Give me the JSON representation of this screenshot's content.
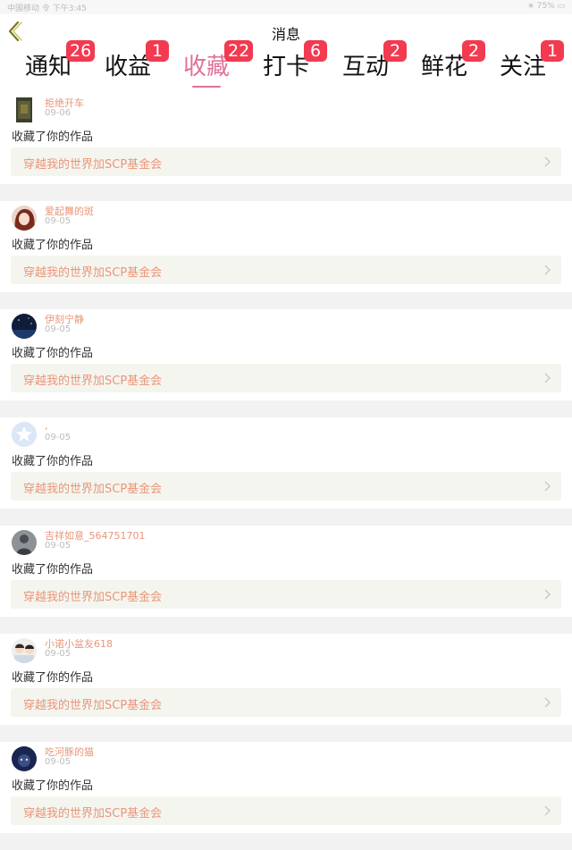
{
  "statusbar": {
    "left": "中国移动 令 下午3:45",
    "right": "∗ 75% ▭"
  },
  "header": {
    "title": "消息",
    "back_icon": "chevron-left-icon"
  },
  "tabs": [
    {
      "label": "通知",
      "badge": "26",
      "active": false
    },
    {
      "label": "收益",
      "badge": "1",
      "active": false
    },
    {
      "label": "收藏",
      "badge": "22",
      "active": true
    },
    {
      "label": "打卡",
      "badge": "6",
      "active": false
    },
    {
      "label": "互动",
      "badge": "2",
      "active": false
    },
    {
      "label": "鲜花",
      "badge": "2",
      "active": false
    },
    {
      "label": "关注",
      "badge": "1",
      "active": false
    }
  ],
  "colors": {
    "accent": "#e0709a",
    "badge": "#f23a50",
    "username": "#e9967a",
    "work_bg": "#f5f5ef"
  },
  "messages": [
    {
      "user": "拒绝开车",
      "date": "09-06",
      "action": "收藏了你的作品",
      "work": "穿越我的世界加SCP基金会",
      "avatar": "dark-tower"
    },
    {
      "user": "爱起舞的斑",
      "date": "09-05",
      "action": "收藏了你的作品",
      "work": "穿越我的世界加SCP基金会",
      "avatar": "anime-girl"
    },
    {
      "user": "伊刻宁静",
      "date": "09-05",
      "action": "收藏了你的作品",
      "work": "穿越我的世界加SCP基金会",
      "avatar": "night-sky"
    },
    {
      "user": ",",
      "date": "09-05",
      "action": "收藏了你的作品",
      "work": "穿越我的世界加SCP基金会",
      "avatar": "default-star"
    },
    {
      "user": "吉祥如意_564751701",
      "date": "09-05",
      "action": "收藏了你的作品",
      "work": "穿越我的世界加SCP基金会",
      "avatar": "person-gray"
    },
    {
      "user": "小诺小盆友618",
      "date": "09-05",
      "action": "收藏了你的作品",
      "work": "穿越我的世界加SCP基金会",
      "avatar": "two-boys"
    },
    {
      "user": "吃河豚的猫",
      "date": "09-05",
      "action": "收藏了你的作品",
      "work": "穿越我的世界加SCP基金会",
      "avatar": "cat-night"
    }
  ]
}
